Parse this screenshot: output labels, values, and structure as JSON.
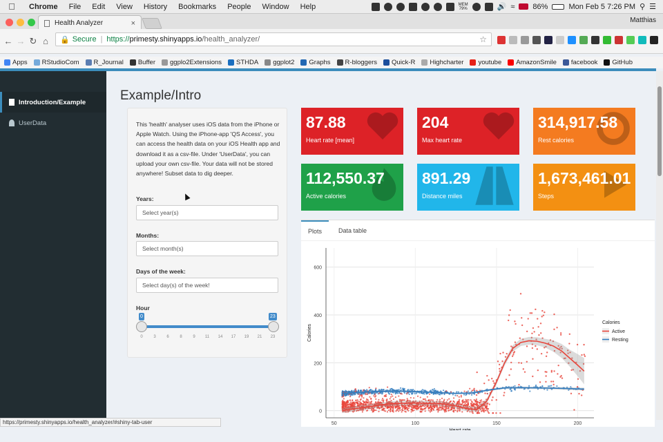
{
  "macmenu": {
    "items": [
      "Chrome",
      "File",
      "Edit",
      "View",
      "History",
      "Bookmarks",
      "People",
      "Window",
      "Help"
    ],
    "battery": "86%",
    "datetime": "Mon Feb 5  7:26 PM",
    "mem_label": "MEM",
    "mem_value": "79%"
  },
  "browser": {
    "tab_title": "Health Analyzer",
    "tab_close": "×",
    "profile": "Matthias",
    "secure_label": "Secure",
    "url_scheme": "https://",
    "url_host": "primesty.shinyapps.io",
    "url_path": "/health_analyzer/",
    "star": "☆",
    "status_url": "https://primesty.shinyapps.io/health_analyzer/#shiny-tab-user"
  },
  "bookmarks": [
    {
      "label": "Apps",
      "color": "#4285f4"
    },
    {
      "label": "RStudioCom",
      "color": "#75aadb"
    },
    {
      "label": "R_Journal",
      "color": "#5b7db1"
    },
    {
      "label": "Buffer",
      "color": "#333333"
    },
    {
      "label": "ggplo2Extensions",
      "color": "#999999"
    },
    {
      "label": "STHDA",
      "color": "#1b6fbf"
    },
    {
      "label": "ggplot2",
      "color": "#888888"
    },
    {
      "label": "Graphs",
      "color": "#2268b3"
    },
    {
      "label": "R-bloggers",
      "color": "#444444"
    },
    {
      "label": "Quick-R",
      "color": "#1c4f9c"
    },
    {
      "label": "Highcharter",
      "color": "#aaaaaa"
    },
    {
      "label": "youtube",
      "color": "#e62117"
    },
    {
      "label": "AmazonSmile",
      "color": "#f90000"
    },
    {
      "label": "facebook",
      "color": "#3b5998"
    },
    {
      "label": "GitHub",
      "color": "#111111"
    }
  ],
  "sidebar": {
    "items": [
      {
        "label": "Introduction/Example",
        "active": true
      },
      {
        "label": "UserData",
        "active": false
      }
    ]
  },
  "main": {
    "title": "Example/Intro",
    "intro": "This 'health' analyser uses iOS data from the iPhone or Apple Watch. Using the iPhone-app 'QS Access', you can access the health data on your iOS Health app and download it as a csv-file. Under 'UserData', you can upload your own csv-file. Your data will not be stored anywhere! Subset data to dig deeper.",
    "filters": {
      "years_label": "Years:",
      "years_placeholder": "Select year(s)",
      "months_label": "Months:",
      "months_placeholder": "Select month(s)",
      "days_label": "Days of the week:",
      "days_placeholder": "Select day(s) of the week!",
      "hour_label": "Hour",
      "hour_min": "0",
      "hour_max": "23",
      "hour_ticks": [
        "0",
        "3",
        "6",
        "8",
        "9",
        "11",
        "14",
        "17",
        "19",
        "21",
        "23"
      ]
    }
  },
  "valueboxes": [
    {
      "value": "87.88",
      "label": "Heart rate [mean]",
      "color": "#dd2227",
      "icon": "heart-icon"
    },
    {
      "value": "204",
      "label": "Max heart rate",
      "color": "#dd2227",
      "icon": "heart-icon"
    },
    {
      "value": "314,917.58",
      "label": "Rest calories",
      "color": "#f47b20",
      "icon": "sun-icon"
    },
    {
      "value": "112,550.37",
      "label": "Active calories",
      "color": "#1fa149",
      "icon": "flame-icon"
    },
    {
      "value": "891.29",
      "label": "Distance miles",
      "color": "#21b6ea",
      "icon": "road-icon"
    },
    {
      "value": "1,673,461.01",
      "label": "Steps",
      "color": "#f39012",
      "icon": "play-icon"
    }
  ],
  "tabs": [
    "Plots",
    "Data table"
  ],
  "chart_data": {
    "type": "scatter",
    "title": "",
    "xlabel": "Heart rate",
    "ylabel": "Calories",
    "xlim": [
      45,
      210
    ],
    "ylim": [
      -30,
      680
    ],
    "xticks": [
      50,
      100,
      150,
      200
    ],
    "yticks": [
      0,
      200,
      400,
      600
    ],
    "legend_title": "Calories",
    "legend_position": "right",
    "series": [
      {
        "name": "Active",
        "color": "#e8443a",
        "trend": [
          [
            55,
            0
          ],
          [
            70,
            15
          ],
          [
            85,
            30
          ],
          [
            100,
            32
          ],
          [
            115,
            30
          ],
          [
            125,
            20
          ],
          [
            132,
            8
          ],
          [
            138,
            5
          ],
          [
            144,
            40
          ],
          [
            150,
            120
          ],
          [
            155,
            200
          ],
          [
            160,
            260
          ],
          [
            165,
            285
          ],
          [
            170,
            292
          ],
          [
            175,
            290
          ],
          [
            180,
            282
          ],
          [
            185,
            270
          ],
          [
            190,
            250
          ],
          [
            195,
            220
          ],
          [
            200,
            190
          ],
          [
            204,
            165
          ]
        ],
        "trend_band": [
          [
            150,
            10
          ],
          [
            165,
            15
          ],
          [
            180,
            18
          ],
          [
            195,
            35
          ],
          [
            204,
            55
          ]
        ]
      },
      {
        "name": "Resting",
        "color": "#2f7bbf",
        "trend": [
          [
            55,
            72
          ],
          [
            70,
            78
          ],
          [
            85,
            82
          ],
          [
            100,
            80
          ],
          [
            115,
            75
          ],
          [
            125,
            72
          ],
          [
            135,
            74
          ],
          [
            145,
            86
          ],
          [
            155,
            95
          ],
          [
            165,
            96
          ],
          [
            175,
            95
          ],
          [
            185,
            94
          ],
          [
            195,
            92
          ],
          [
            204,
            90
          ]
        ],
        "trend_band": [
          [
            55,
            5
          ],
          [
            120,
            3
          ],
          [
            204,
            6
          ]
        ]
      }
    ]
  }
}
